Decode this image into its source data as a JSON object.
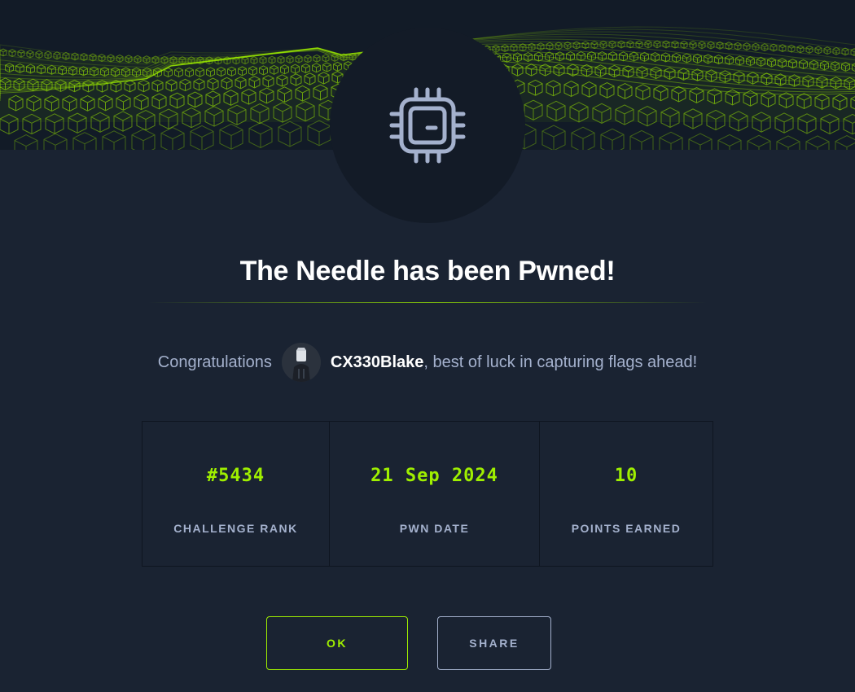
{
  "modal": {
    "title": "The Needle has been Pwned!",
    "congrats_prefix": "Congratulations",
    "username": "CX330Blake",
    "congrats_suffix": ", best of luck in capturing flags ahead!"
  },
  "stats": [
    {
      "value": "#5434",
      "label": "CHALLENGE RANK"
    },
    {
      "value": "21 Sep 2024",
      "label": "PWN DATE"
    },
    {
      "value": "10",
      "label": "POINTS EARNED"
    }
  ],
  "buttons": {
    "ok": "OK",
    "share": "SHARE"
  },
  "icons": {
    "emblem": "cpu-chip-icon",
    "banner": "green-cube-wave-pattern"
  },
  "colors": {
    "accent": "#9fef00",
    "background": "#1a2332",
    "muted_text": "#a4b1cd"
  }
}
